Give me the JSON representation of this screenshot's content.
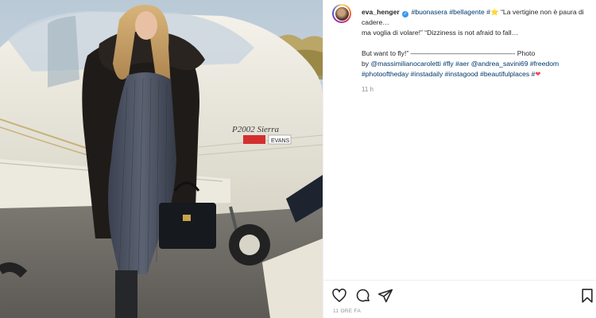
{
  "post": {
    "username": "eva_henger",
    "caption_lines": [
      "ma voglia di volare!” “Dizziness is not afraid to fall…"
    ],
    "caption_head_tags": [
      "#buonasera",
      "#bellagente",
      "#"
    ],
    "caption_head_text": " “La vertigine non è paura di cadere…",
    "caption_but": "But want to fly!” ———————————————- Photo",
    "caption_by": "by ",
    "mentions": [
      "@massimilianocaroletti",
      "@andrea_savini69"
    ],
    "tags_line2": [
      "#fly",
      "#aer"
    ],
    "tags_line2b": [
      "#freedom"
    ],
    "tags_line3": [
      "#photooftheday",
      "#instadaily",
      "#instagood",
      "#beautifulplaces",
      "#"
    ],
    "time_ago": "11 h",
    "timestamp": "11 ORE FA"
  },
  "photo": {
    "plane_text": "P2002 Sierra",
    "badge_red": "",
    "badge_evans": "EVANS"
  },
  "icons": {
    "like": "heart-icon",
    "comment": "comment-icon",
    "share": "share-icon",
    "save": "bookmark-icon",
    "verified": "verified-icon",
    "star": "star-icon"
  },
  "colors": {
    "link": "#00376b",
    "text": "#262626",
    "muted": "#8e8e8e",
    "verified": "#3897f0",
    "heart": "#ed4956"
  }
}
